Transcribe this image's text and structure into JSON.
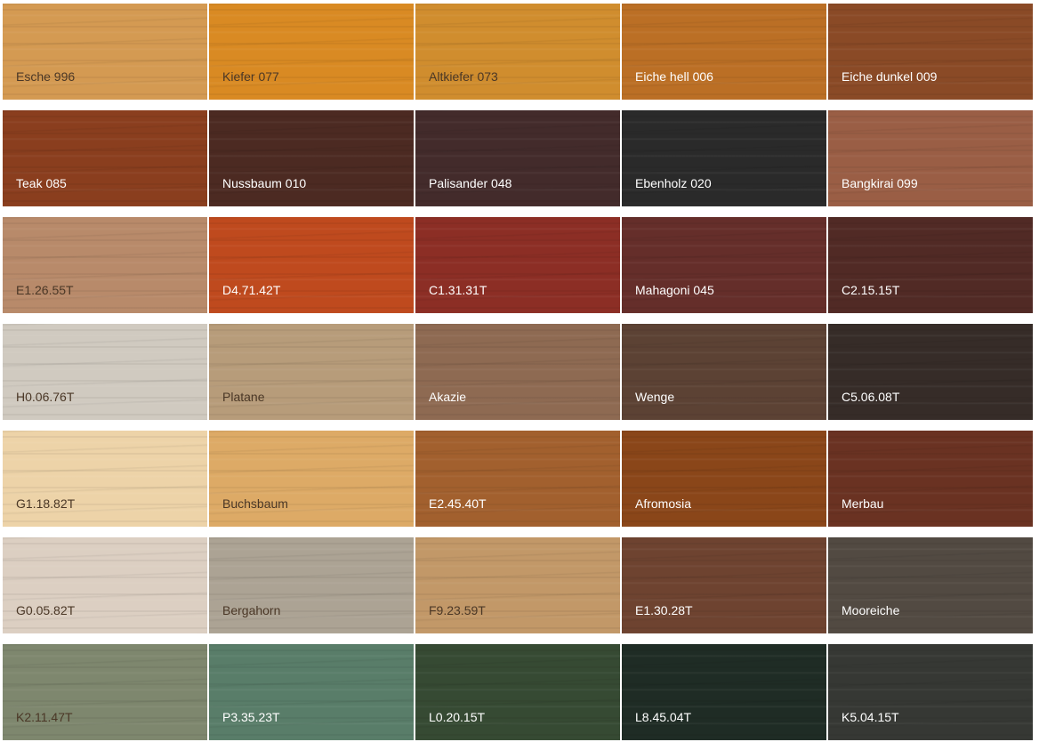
{
  "swatches": [
    [
      {
        "name": "Esche 996",
        "color": "#D49A52",
        "text": "#4a3726"
      },
      {
        "name": "Kiefer 077",
        "color": "#D98A23",
        "text": "#4a3726"
      },
      {
        "name": "Altkiefer 073",
        "color": "#D08D2E",
        "text": "#4a3726"
      },
      {
        "name": "Eiche hell 006",
        "color": "#BB6F25",
        "text": "#ffffff"
      },
      {
        "name": "Eiche dunkel 009",
        "color": "#8A4A26",
        "text": "#ffffff"
      }
    ],
    [
      {
        "name": "Teak 085",
        "color": "#8A3E1E",
        "text": "#ffffff"
      },
      {
        "name": "Nussbaum 010",
        "color": "#4C2A22",
        "text": "#ffffff"
      },
      {
        "name": "Palisander 048",
        "color": "#432B2B",
        "text": "#ffffff"
      },
      {
        "name": "Ebenholz 020",
        "color": "#2A2A2A",
        "text": "#ffffff"
      },
      {
        "name": "Bangkirai 099",
        "color": "#9A5E45",
        "text": "#ffffff"
      }
    ],
    [
      {
        "name": "E1.26.55T",
        "color": "#B88A6A",
        "text": "#4a3726"
      },
      {
        "name": "D4.71.42T",
        "color": "#BF4A1E",
        "text": "#ffffff"
      },
      {
        "name": "C1.31.31T",
        "color": "#8C2E25",
        "text": "#ffffff"
      },
      {
        "name": "Mahagoni 045",
        "color": "#652E2A",
        "text": "#ffffff"
      },
      {
        "name": "C2.15.15T",
        "color": "#512A25",
        "text": "#ffffff"
      }
    ],
    [
      {
        "name": "H0.06.76T",
        "color": "#D0CAC0",
        "text": "#4a3726"
      },
      {
        "name": "Platane",
        "color": "#B79C7A",
        "text": "#4a3726"
      },
      {
        "name": "Akazie",
        "color": "#8E6A52",
        "text": "#ffffff"
      },
      {
        "name": "Wenge",
        "color": "#5C4234",
        "text": "#ffffff"
      },
      {
        "name": "C5.06.08T",
        "color": "#362C28",
        "text": "#ffffff"
      }
    ],
    [
      {
        "name": "G1.18.82T",
        "color": "#EDD3A8",
        "text": "#4a3726"
      },
      {
        "name": "Buchsbaum",
        "color": "#DDAA66",
        "text": "#4a3726"
      },
      {
        "name": "E2.45.40T",
        "color": "#A2602E",
        "text": "#ffffff"
      },
      {
        "name": "Afromosia",
        "color": "#8A4619",
        "text": "#ffffff"
      },
      {
        "name": "Merbau",
        "color": "#6A3222",
        "text": "#ffffff"
      }
    ],
    [
      {
        "name": "G0.05.82T",
        "color": "#DCCFC2",
        "text": "#4a3726"
      },
      {
        "name": "Bergahorn",
        "color": "#ACA394",
        "text": "#4a3726"
      },
      {
        "name": "F9.23.59T",
        "color": "#C29868",
        "text": "#4a3726"
      },
      {
        "name": "E1.30.28T",
        "color": "#6E4330",
        "text": "#ffffff"
      },
      {
        "name": "Mooreiche",
        "color": "#524A42",
        "text": "#ffffff"
      }
    ],
    [
      {
        "name": "K2.11.47T",
        "color": "#7E876E",
        "text": "#4a3726"
      },
      {
        "name": "P3.35.23T",
        "color": "#597D69",
        "text": "#ffffff"
      },
      {
        "name": "L0.20.15T",
        "color": "#364A33",
        "text": "#ffffff"
      },
      {
        "name": "L8.45.04T",
        "color": "#1F2C25",
        "text": "#ffffff"
      },
      {
        "name": "K5.04.15T",
        "color": "#363834",
        "text": "#ffffff"
      }
    ]
  ]
}
